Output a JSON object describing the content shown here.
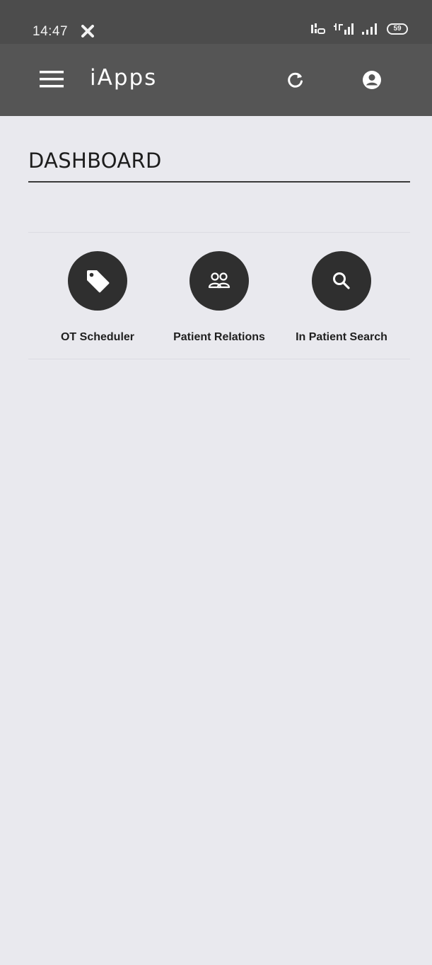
{
  "status_bar": {
    "time": "14:47",
    "battery_level": "59",
    "icons": [
      "close-icon",
      "volte-icon",
      "signal-4g-icon",
      "signal-bars-icon",
      "battery-icon"
    ]
  },
  "app_bar": {
    "title": "iApps",
    "icons": [
      "menu-icon",
      "refresh-icon",
      "account-circle-icon"
    ]
  },
  "dashboard": {
    "title": "DASHBOARD",
    "apps": [
      {
        "label": "OT Scheduler",
        "icon": "tag-icon"
      },
      {
        "label": "Patient Relations",
        "icon": "people-icon"
      },
      {
        "label": "In Patient Search",
        "icon": "search-icon"
      }
    ]
  },
  "colors": {
    "app_bar": "#555555",
    "status_bar": "#4c4c4c",
    "background": "#e9e9ee",
    "icon_circle": "#2f2f2f"
  }
}
